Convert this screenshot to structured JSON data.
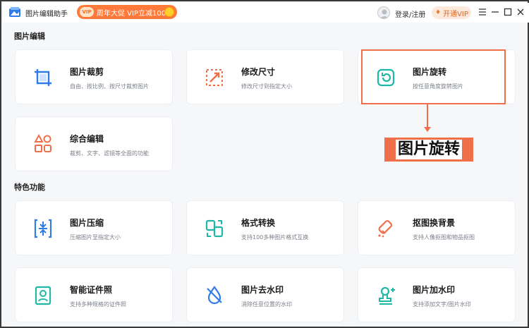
{
  "titlebar": {
    "app_title": "图片编辑助手",
    "promo_badge": "VIP",
    "promo_text": "周年大促 VIP立减100元",
    "login": "登录/注册",
    "vip_button": "开通VIP",
    "controls": [
      "menu-icon",
      "minimize-icon",
      "maximize-icon",
      "close-icon"
    ]
  },
  "sections": {
    "edit_title": "图片编辑",
    "feature_title": "特色功能"
  },
  "edit_cards": [
    {
      "name": "图片裁剪",
      "desc": "自由、按比例、按尺寸裁剪图片",
      "icon": "crop-icon"
    },
    {
      "name": "修改尺寸",
      "desc": "修改尺寸到指定大小",
      "icon": "resize-icon"
    },
    {
      "name": "图片旋转",
      "desc": "按任意角度旋转图片",
      "icon": "rotate-icon"
    },
    {
      "name": "综合编辑",
      "desc": "裁剪、文字、滤镜等全面的功能",
      "icon": "grid-shapes-icon"
    }
  ],
  "feature_cards": [
    {
      "name": "图片压缩",
      "desc": "压缩图片至指定大小",
      "icon": "compress-icon"
    },
    {
      "name": "格式转换",
      "desc": "支持100多种图片格式互换",
      "icon": "convert-icon"
    },
    {
      "name": "抠图换背景",
      "desc": "支持人像抠图和物品抠图",
      "icon": "eraser-icon"
    },
    {
      "name": "智能证件照",
      "desc": "支持多种规格的证件照",
      "icon": "id-photo-icon"
    },
    {
      "name": "图片去水印",
      "desc": "消除任意位置的水印",
      "icon": "remove-watermark-icon"
    },
    {
      "name": "图片加水印",
      "desc": "支持添加文字/图片水印",
      "icon": "add-watermark-icon"
    }
  ],
  "callout": {
    "text": "图片旋转"
  },
  "colors": {
    "accent": "#ef6f4a",
    "blue": "#2f7be8",
    "teal": "#1fb8a6",
    "promo": "#ff7a3a"
  }
}
